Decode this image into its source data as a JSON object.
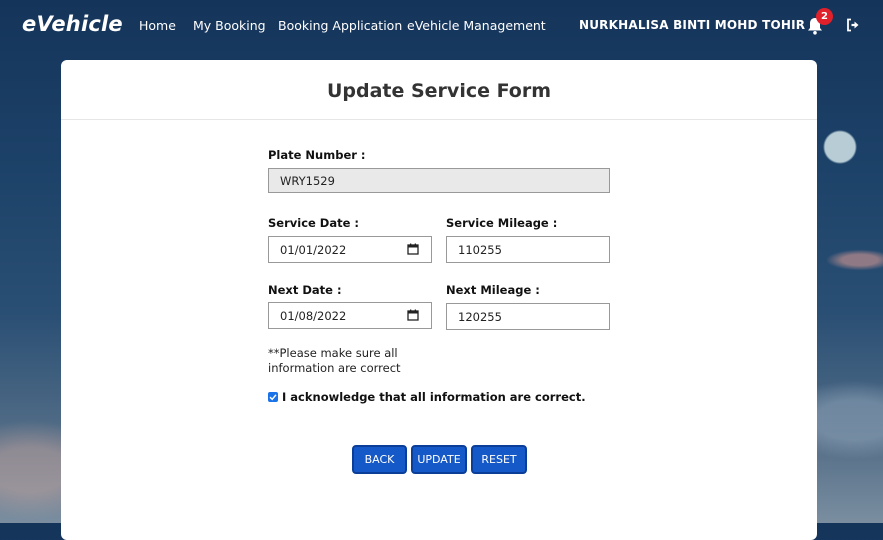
{
  "brand": "eVehicle",
  "nav": [
    "Home",
    "My Booking",
    "Booking Application",
    "eVehicle Management"
  ],
  "user": {
    "name": "NURKHALISA BINTI MOHD TOHIR",
    "notification_count": "2"
  },
  "form": {
    "title": "Update Service Form",
    "plate_label": "Plate Number :",
    "plate_value": "WRY1529",
    "service_date_label": "Service Date :",
    "service_date_value": "01/01/2022",
    "service_mileage_label": "Service Mileage :",
    "service_mileage_value": "110255",
    "next_date_label": "Next Date :",
    "next_date_value": "01/08/2022",
    "next_mileage_label": "Next Mileage :",
    "next_mileage_value": "120255",
    "note_line1": "**Please make sure all",
    "note_line2": "information are correct",
    "ack_text": "I acknowledge that all information are correct.",
    "ack_checked": true
  },
  "buttons": {
    "back": "BACK",
    "update": "UPDATE",
    "reset": "RESET"
  },
  "icons": {
    "bell": "bell-icon",
    "logout": "logout-icon",
    "calendar": "calendar-icon",
    "check": "checkmark-icon"
  },
  "colors": {
    "button_bg": "#1558c7",
    "badge": "#e0202a",
    "checkbox": "#1a73e8"
  }
}
